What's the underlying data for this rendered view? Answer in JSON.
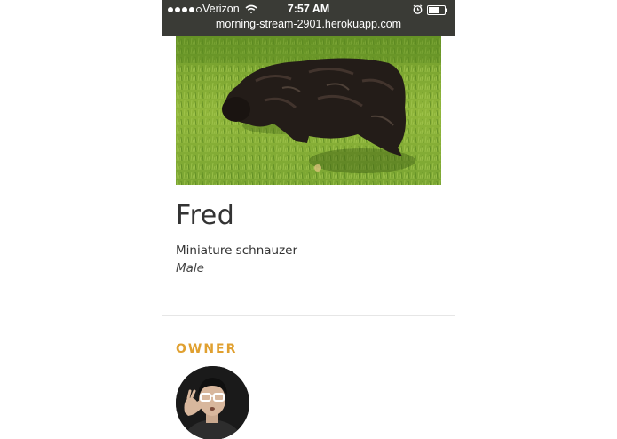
{
  "status_bar": {
    "carrier": "Verizon",
    "time": "7:57 AM",
    "signal_icon": "signal-dots-icon",
    "wifi_icon": "wifi-icon",
    "alarm_icon": "alarm-clock-icon",
    "battery_icon": "battery-icon"
  },
  "browser": {
    "url": "morning-stream-2901.herokuapp.com"
  },
  "dog": {
    "name": "Fred",
    "breed": "Miniature schnauzer",
    "sex": "Male"
  },
  "owner": {
    "heading": "OWNER"
  },
  "colors": {
    "accent": "#e0a030",
    "status_bar_bg": "#3a3b36",
    "text": "#333333"
  }
}
